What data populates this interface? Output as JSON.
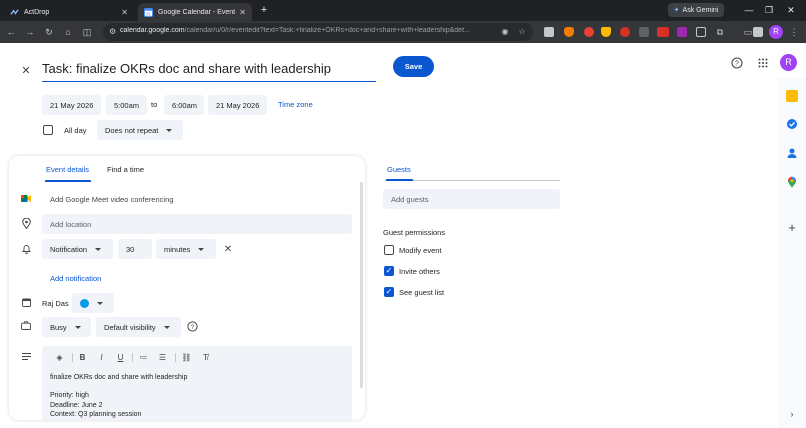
{
  "browser": {
    "tabs": [
      {
        "title": "ActDrop",
        "active": false
      },
      {
        "title": "Google Calendar - Event details",
        "active": true
      }
    ],
    "gemini_label": "Ask Gemini",
    "url_host": "calendar.google.com",
    "url_path": "/calendar/u/0/r/eventedit?text=Task:+finalize+OKRs+doc+and+share+with+leadership&det...",
    "profile_initial": "R"
  },
  "event": {
    "title": "Task: finalize OKRs doc and share with leadership",
    "save_label": "Save",
    "start_date": "21 May 2026",
    "start_time": "5:00am",
    "to_label": "to",
    "end_time": "6:00am",
    "end_date": "21 May 2026",
    "timezone_label": "Time zone",
    "all_day_label": "All day",
    "repeat_value": "Does not repeat",
    "profile_initial": "R"
  },
  "tabs": {
    "event_details": "Event details",
    "find_time": "Find a time",
    "guests": "Guests"
  },
  "details": {
    "meet_label": "Add Google Meet video conferencing",
    "location_placeholder": "Add location",
    "notification_type": "Notification",
    "notification_value": "30",
    "notification_unit": "minutes",
    "add_notification_label": "Add notification",
    "organizer": "Raj Das",
    "busy_value": "Busy",
    "visibility_value": "Default visibility",
    "description_lines": [
      "finalize OKRs doc and share with leadership",
      "",
      "Priority: high",
      "Deadline: June 2",
      "Context: Q3 planning session"
    ]
  },
  "guests": {
    "add_placeholder": "Add guests",
    "permissions_title": "Guest permissions",
    "permissions": [
      {
        "label": "Modify event",
        "checked": false
      },
      {
        "label": "Invite others",
        "checked": true
      },
      {
        "label": "See guest list",
        "checked": true
      }
    ]
  },
  "colors": {
    "accent": "#0b57d0",
    "event_color": "#039be5",
    "chip_bg": "#f0f4f9"
  }
}
